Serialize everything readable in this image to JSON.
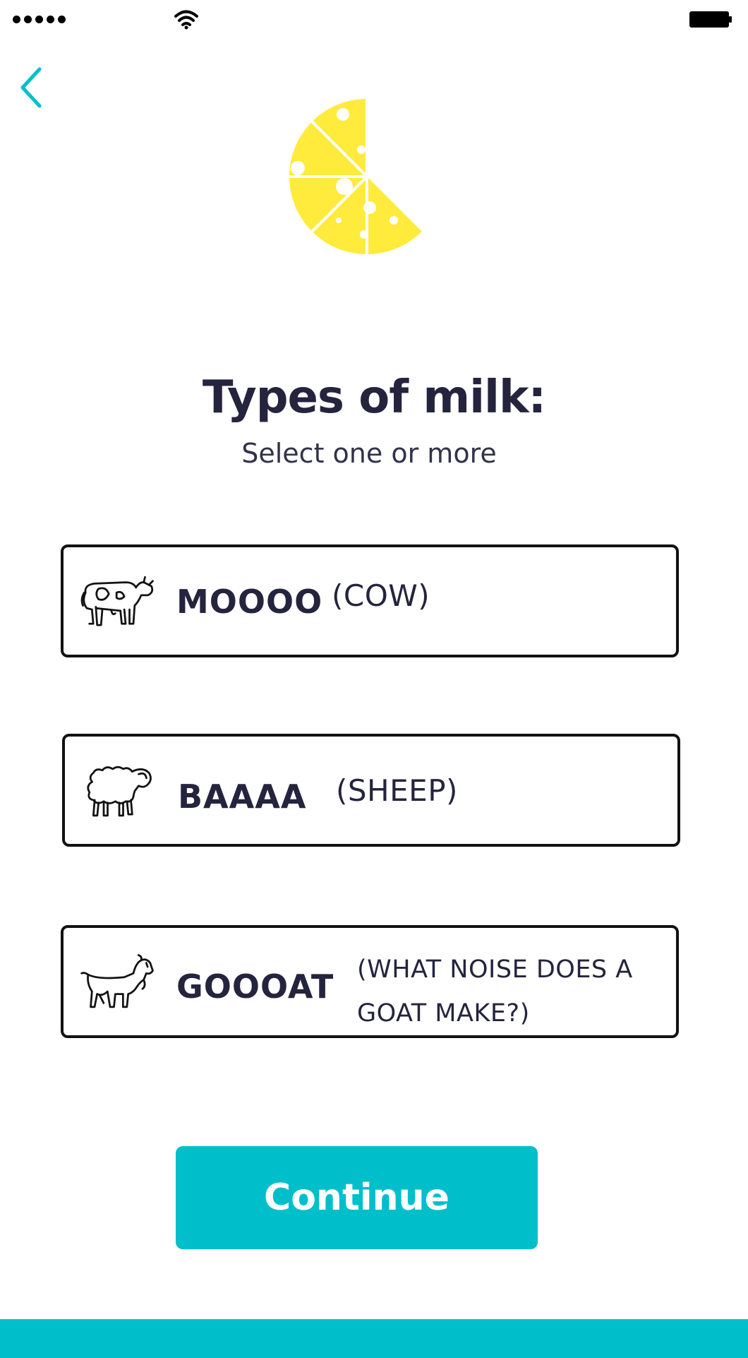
{
  "status_bar": {
    "signal_icon": "signal-dots-icon",
    "wifi_icon": "wifi-icon",
    "battery_icon": "battery-icon"
  },
  "nav": {
    "back_icon": "chevron-left-icon",
    "accent_color": "#00bfcb"
  },
  "hero": {
    "icon": "cheese-wedge-icon",
    "color": "#ffeb3b"
  },
  "header": {
    "title": "Types of milk:",
    "subtitle": "Select one or more"
  },
  "options": [
    {
      "name": "MOOOO",
      "note": "(COW)",
      "icon": "cow-icon"
    },
    {
      "name": "BAAAA",
      "note": "(SHEEP)",
      "icon": "sheep-icon"
    },
    {
      "name": "GOOOAT",
      "note": "(WHAT NOISE DOES A GOAT MAKE?)",
      "icon": "goat-icon"
    }
  ],
  "footer": {
    "continue_label": "Continue",
    "button_color": "#00bfcb"
  }
}
